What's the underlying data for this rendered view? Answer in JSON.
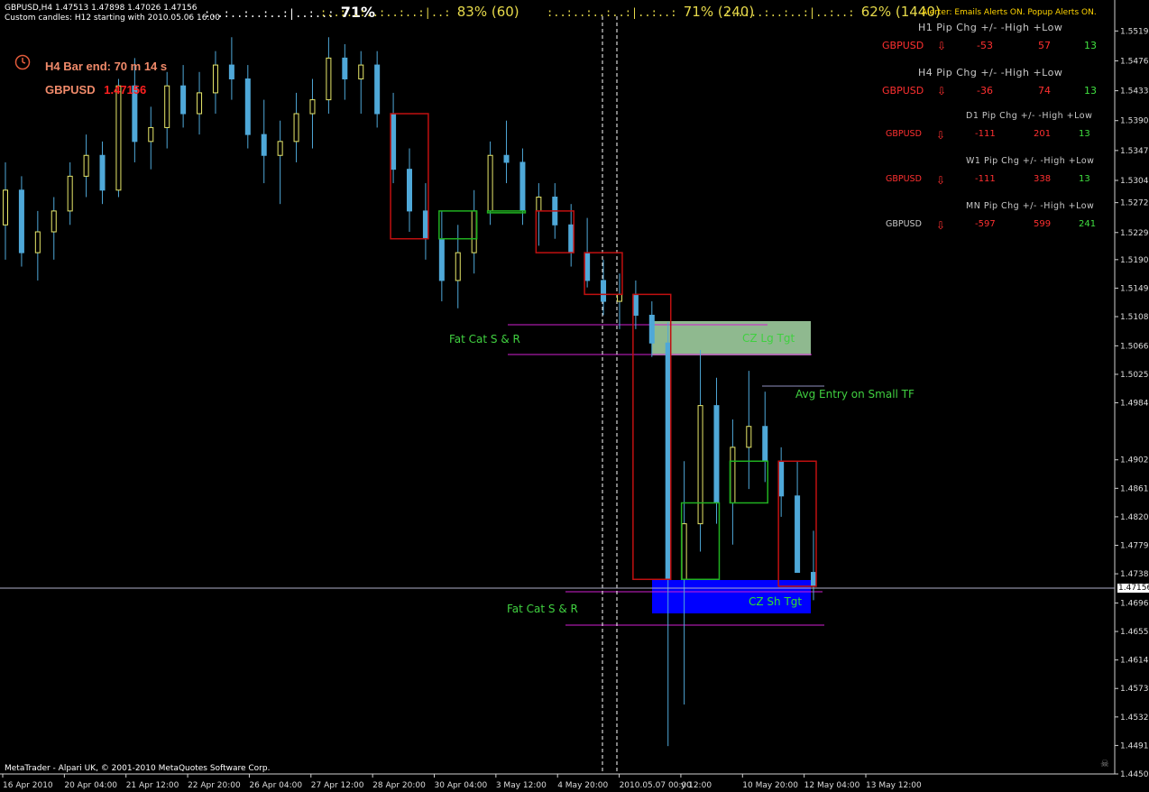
{
  "header": {
    "line1": "GBPUSD,H4  1.47513 1.47898 1.47026 1.47156",
    "line2": "Custom candles: H12 starting with 2010.05.06 16:00"
  },
  "strength": [
    {
      "bar": ":..:..:..:..:|..:..:",
      "value": "71%",
      "color": "#ffffff"
    },
    {
      "bar": ":..:..:..:..:..:|..:",
      "value": "83%  (60)",
      "color": "#e6d94a"
    },
    {
      "bar": ":..:..:..:..:|..:..:",
      "value": "71%  (240)",
      "color": "#e6d94a"
    },
    {
      "bar": ":..:..:..:..:|..:..:",
      "value": "62%  (1440)",
      "color": "#e6d94a"
    }
  ],
  "bar_timer": {
    "text": "H4 Bar end: 70 m 14 s",
    "symbol": "GBPUSD",
    "price": "1.47156"
  },
  "alerter": "Alerter:  Emails Alerts ON.  Popup Alerts ON.",
  "pip_groups": [
    {
      "label": "H1 Pip Chg +/- -High +Low",
      "symbol": "GBPUSD",
      "chg": "-53",
      "high": "57",
      "low": "13",
      "sym_color": "#ff3030",
      "chg_color": "#ff3030"
    },
    {
      "label": "H4 Pip Chg +/- -High +Low",
      "symbol": "GBPUSD",
      "chg": "-36",
      "high": "74",
      "low": "13",
      "sym_color": "#ff3030",
      "chg_color": "#ff3030"
    },
    {
      "label": "D1 Pip Chg +/- -High +Low",
      "symbol": "GBPUSD",
      "chg": "-111",
      "high": "201",
      "low": "13",
      "sym_color": "#ff3030",
      "chg_color": "#ff3030"
    },
    {
      "label": "W1 Pip Chg +/- -High +Low",
      "symbol": "GBPUSD",
      "chg": "-111",
      "high": "338",
      "low": "13",
      "sym_color": "#ff3030",
      "chg_color": "#ff3030"
    },
    {
      "label": "MN Pip Chg +/- -High +Low",
      "symbol": "GBPUSD",
      "chg": "-597",
      "high": "599",
      "low": "241",
      "sym_color": "#c8c8c8",
      "chg_color": "#ff3030"
    }
  ],
  "annotations": {
    "fatcat_top": "Fat Cat S & R",
    "fatcat_bottom": "Fat Cat S & R",
    "cz_lg": "CZ Lg Tgt",
    "cz_sh": "CZ Sh Tgt",
    "avg_entry": "Avg Entry on Small TF"
  },
  "copyright": "MetaTrader - Alpari UK, © 2001-2010 MetaQuotes Software Corp.",
  "current_price": "1.47156",
  "price_ticks": [
    "1.55190",
    "1.54760",
    "1.54330",
    "1.53900",
    "1.53470",
    "1.53040",
    "1.52720",
    "1.52290",
    "1.51900",
    "1.51490",
    "1.51080",
    "1.50660",
    "1.50250",
    "1.49840",
    "1.49020",
    "1.48610",
    "1.48200",
    "1.47790",
    "1.47380",
    "1.46960",
    "1.46550",
    "1.46140",
    "1.45730",
    "1.45320",
    "1.44910",
    "1.44500"
  ],
  "time_ticks": [
    "16 Apr 2010",
    "20 Apr 04:00",
    "21 Apr 12:00",
    "22 Apr 20:00",
    "26 Apr 04:00",
    "27 Apr 12:00",
    "28 Apr 20:00",
    "30 Apr 04:00",
    "3 May 12:00",
    "4 May 20:00",
    "2010.05.07 00:00",
    "y 12:00",
    "10 May 20:00",
    "12 May 04:00",
    "13 May 12:00"
  ],
  "chart_data": {
    "type": "candlestick",
    "symbol": "GBPUSD",
    "timeframe": "H4",
    "ylim": [
      1.445,
      1.5535
    ],
    "candles": [
      [
        1.524,
        1.533,
        1.519,
        1.529
      ],
      [
        1.529,
        1.531,
        1.518,
        1.52
      ],
      [
        1.52,
        1.526,
        1.516,
        1.523
      ],
      [
        1.523,
        1.528,
        1.519,
        1.526
      ],
      [
        1.526,
        1.533,
        1.524,
        1.531
      ],
      [
        1.531,
        1.537,
        1.528,
        1.534
      ],
      [
        1.534,
        1.536,
        1.527,
        1.529
      ],
      [
        1.529,
        1.545,
        1.528,
        1.544
      ],
      [
        1.544,
        1.548,
        1.533,
        1.536
      ],
      [
        1.536,
        1.541,
        1.532,
        1.538
      ],
      [
        1.538,
        1.546,
        1.535,
        1.544
      ],
      [
        1.544,
        1.547,
        1.538,
        1.54
      ],
      [
        1.54,
        1.546,
        1.537,
        1.543
      ],
      [
        1.543,
        1.549,
        1.54,
        1.547
      ],
      [
        1.547,
        1.551,
        1.542,
        1.545
      ],
      [
        1.545,
        1.547,
        1.535,
        1.537
      ],
      [
        1.537,
        1.542,
        1.53,
        1.534
      ],
      [
        1.534,
        1.539,
        1.527,
        1.536
      ],
      [
        1.536,
        1.543,
        1.533,
        1.54
      ],
      [
        1.54,
        1.545,
        1.535,
        1.542
      ],
      [
        1.542,
        1.551,
        1.54,
        1.548
      ],
      [
        1.548,
        1.55,
        1.542,
        1.545
      ],
      [
        1.545,
        1.549,
        1.54,
        1.547
      ],
      [
        1.547,
        1.549,
        1.538,
        1.54
      ],
      [
        1.54,
        1.543,
        1.53,
        1.532
      ],
      [
        1.532,
        1.535,
        1.523,
        1.526
      ],
      [
        1.526,
        1.53,
        1.519,
        1.522
      ],
      [
        1.522,
        1.526,
        1.513,
        1.516
      ],
      [
        1.516,
        1.524,
        1.512,
        1.52
      ],
      [
        1.52,
        1.529,
        1.517,
        1.526
      ],
      [
        1.526,
        1.536,
        1.524,
        1.534
      ],
      [
        1.534,
        1.539,
        1.53,
        1.533
      ],
      [
        1.533,
        1.535,
        1.524,
        1.526
      ],
      [
        1.526,
        1.53,
        1.521,
        1.528
      ],
      [
        1.528,
        1.53,
        1.522,
        1.524
      ],
      [
        1.524,
        1.527,
        1.518,
        1.52
      ],
      [
        1.52,
        1.525,
        1.515,
        1.516
      ],
      [
        1.516,
        1.519,
        1.511,
        1.513
      ],
      [
        1.513,
        1.517,
        1.509,
        1.514
      ],
      [
        1.514,
        1.516,
        1.509,
        1.511
      ],
      [
        1.511,
        1.513,
        1.505,
        1.507
      ],
      [
        1.507,
        1.51,
        1.449,
        1.473
      ],
      [
        1.473,
        1.49,
        1.455,
        1.481
      ],
      [
        1.481,
        1.506,
        1.477,
        1.498
      ],
      [
        1.498,
        1.502,
        1.481,
        1.484
      ],
      [
        1.484,
        1.496,
        1.478,
        1.492
      ],
      [
        1.492,
        1.503,
        1.486,
        1.495
      ],
      [
        1.495,
        1.5,
        1.487,
        1.49
      ],
      [
        1.49,
        1.492,
        1.482,
        1.485
      ],
      [
        1.485,
        1.49,
        1.477,
        1.474
      ],
      [
        1.474,
        1.48,
        1.47,
        1.472
      ]
    ]
  }
}
